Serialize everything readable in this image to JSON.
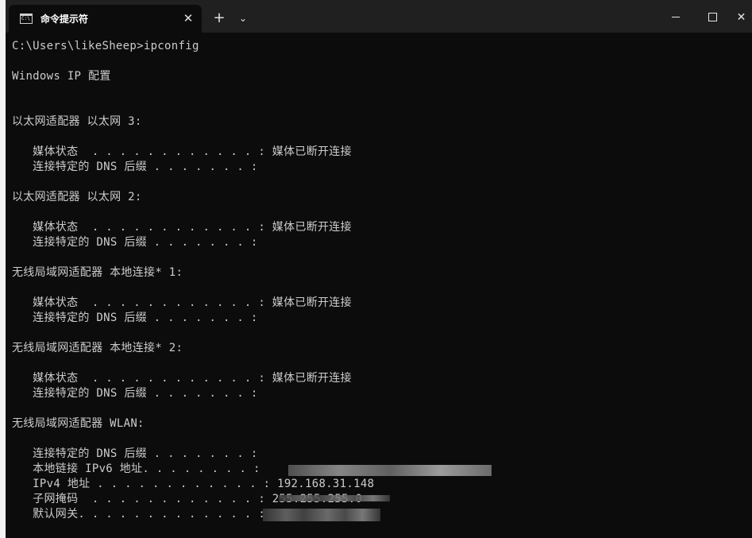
{
  "window": {
    "tab_title": "命令提示符",
    "tab_icon_text": "C:\\",
    "close_tab_glyph": "✕",
    "new_tab_glyph": "+",
    "dropdown_glyph": "⌄",
    "close_window_glyph": "✕"
  },
  "console": {
    "lines": [
      "C:\\Users\\likeSheep>ipconfig",
      "",
      "Windows IP 配置",
      "",
      "",
      "以太网适配器 以太网 3:",
      "",
      "   媒体状态  . . . . . . . . . . . . : 媒体已断开连接",
      "   连接特定的 DNS 后缀 . . . . . . . :",
      "",
      "以太网适配器 以太网 2:",
      "",
      "   媒体状态  . . . . . . . . . . . . : 媒体已断开连接",
      "   连接特定的 DNS 后缀 . . . . . . . :",
      "",
      "无线局域网适配器 本地连接* 1:",
      "",
      "   媒体状态  . . . . . . . . . . . . : 媒体已断开连接",
      "   连接特定的 DNS 后缀 . . . . . . . :",
      "",
      "无线局域网适配器 本地连接* 2:",
      "",
      "   媒体状态  . . . . . . . . . . . . : 媒体已断开连接",
      "   连接特定的 DNS 后缀 . . . . . . . :",
      "",
      "无线局域网适配器 WLAN:",
      "",
      "   连接特定的 DNS 后缀 . . . . . . . :",
      "   本地链接 IPv6 地址. . . . . . . . :",
      "   IPv4 地址 . . . . . . . . . . . . : 192.168.31.148",
      "   子网掩码  . . . . . . . . . . . . : 255.255.255.0",
      "   默认网关. . . . . . . . . . . . . :"
    ]
  },
  "colors": {
    "terminal_bg": "#0c0c0c",
    "titlebar_bg": "#202020",
    "text": "#cccccc"
  }
}
